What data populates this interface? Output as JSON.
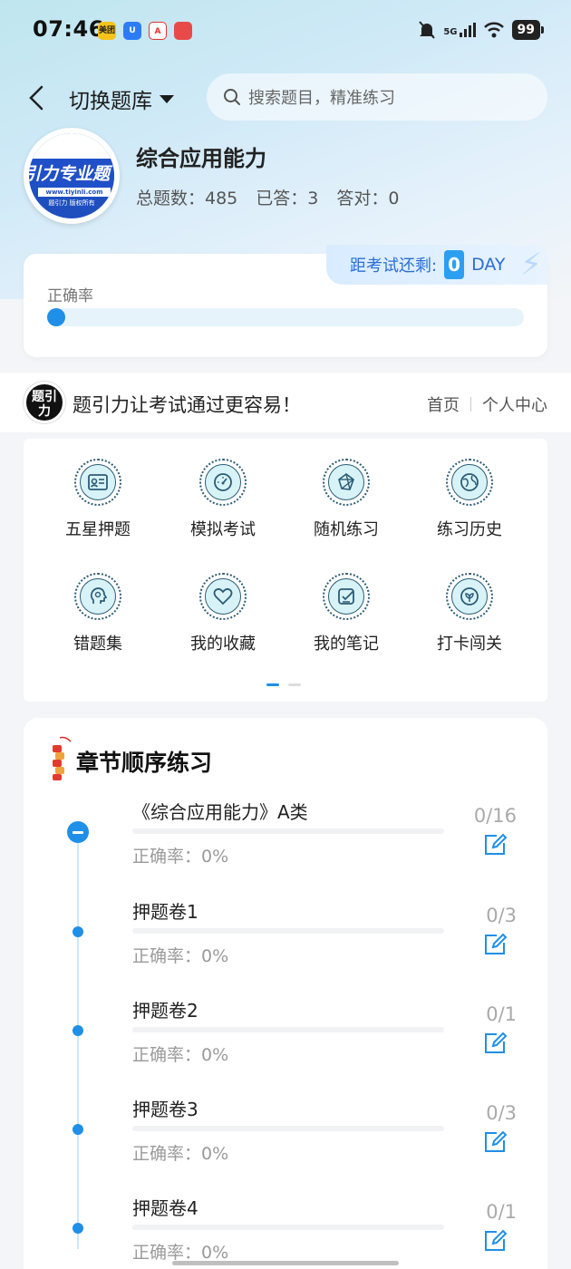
{
  "status_bar": {
    "time": "07:46",
    "network": "5G",
    "battery": "99",
    "app_icons": [
      {
        "label": "美团",
        "color": "#f7c21a"
      },
      {
        "label": "U",
        "color": "#2d7cf6"
      },
      {
        "label": "A",
        "color": "#e8352b"
      },
      {
        "label": "",
        "color": "#e84a4a"
      }
    ]
  },
  "header": {
    "switch_label": "切换题库",
    "search_placeholder": "搜索题目，精准练习"
  },
  "profile": {
    "logo_text": "引力专业题",
    "logo_url": "www.tiyinli.com",
    "logo_copyright": "题引力 版权所有",
    "bank_name": "综合应用能力",
    "total_label": "总题数：485",
    "answered_label": "已答：3",
    "correct_label": "答对：0"
  },
  "accuracy": {
    "label": "正确率",
    "value_fraction": 0,
    "exam_countdown_label": "距考试还剩:",
    "days": "0",
    "day_unit": "DAY"
  },
  "slogan": {
    "logo_text": "题引力",
    "text": "题引力让考试通过更容易！",
    "link_home": "首页",
    "link_profile": "个人中心"
  },
  "functions": [
    {
      "label": "五星押题",
      "icon": "id-card-icon"
    },
    {
      "label": "模拟考试",
      "icon": "speedometer-icon"
    },
    {
      "label": "随机练习",
      "icon": "network-icon"
    },
    {
      "label": "练习历史",
      "icon": "globe-icon"
    },
    {
      "label": "错题集",
      "icon": "head-icon"
    },
    {
      "label": "我的收藏",
      "icon": "heart-icon"
    },
    {
      "label": "我的笔记",
      "icon": "note-icon"
    },
    {
      "label": "打卡闯关",
      "icon": "leaf-icon"
    }
  ],
  "chapters": {
    "title": "章节顺序练习",
    "items": [
      {
        "name": "《综合应用能力》A类",
        "accuracy": "正确率：0%",
        "count": "0/16"
      },
      {
        "name": "押题卷1",
        "accuracy": "正确率：0%",
        "count": "0/3"
      },
      {
        "name": "押题卷2",
        "accuracy": "正确率：0%",
        "count": "0/1"
      },
      {
        "name": "押题卷3",
        "accuracy": "正确率：0%",
        "count": "0/3"
      },
      {
        "name": "押题卷4",
        "accuracy": "正确率：0%",
        "count": "0/1"
      }
    ]
  },
  "colors": {
    "accent": "#1f8fe8",
    "icon_bg": "#d8f3f8",
    "icon_stroke": "#2c5c75"
  }
}
